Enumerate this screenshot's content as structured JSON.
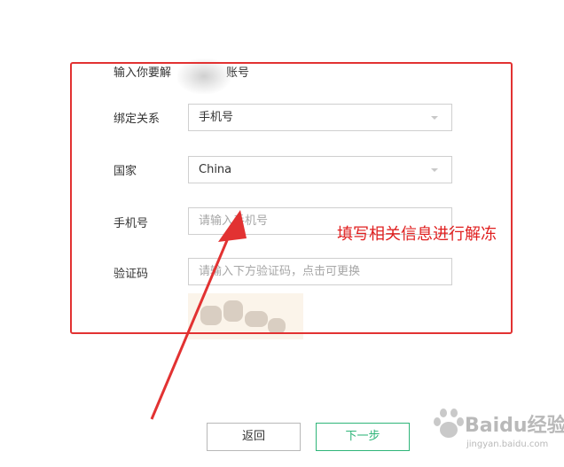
{
  "form": {
    "heading_prefix": "输入你要解",
    "heading_suffix": "账号",
    "binding": {
      "label": "绑定关系",
      "value": "手机号"
    },
    "country": {
      "label": "国家",
      "value": "China"
    },
    "phone": {
      "label": "手机号",
      "placeholder": "请输入手机号"
    },
    "captcha": {
      "label": "验证码",
      "placeholder": "请输入下方验证码，点击可更换"
    }
  },
  "annotation": {
    "text": "填写相关信息进行解冻",
    "color": "#e02020"
  },
  "buttons": {
    "back": "返回",
    "next": "下一步"
  },
  "watermark": {
    "brand": "Baidu经验",
    "url": "jingyan.baidu.com"
  },
  "colors": {
    "accent_green": "#2fb579",
    "annotation_red": "#e23232"
  }
}
